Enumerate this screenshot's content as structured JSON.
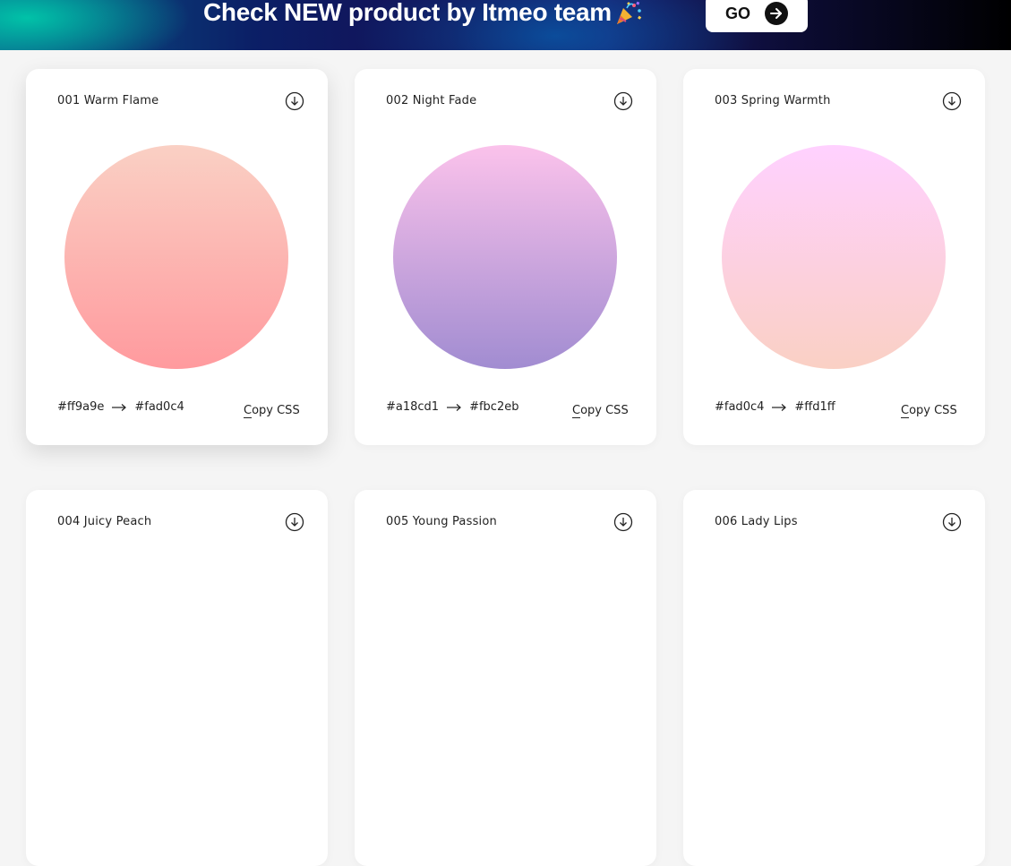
{
  "banner": {
    "text": "Check NEW product by Itmeo team",
    "emoji_icon": "party-popper-icon",
    "go_label": "GO",
    "go_icon": "arrow-right-icon"
  },
  "copy_label_first": "C",
  "copy_label_rest": "opy CSS",
  "cards": [
    {
      "title": "001 Warm Flame",
      "from": "#ff9a9e",
      "to": "#fad0c4",
      "from_label": "#ff9a9e",
      "to_label": "#fad0c4"
    },
    {
      "title": "002 Night Fade",
      "from": "#a18cd1",
      "to": "#fbc2eb",
      "from_label": "#a18cd1",
      "to_label": "#fbc2eb"
    },
    {
      "title": "003 Spring Warmth",
      "from": "#fad0c4",
      "to": "#ffd1ff",
      "from_label": "#fad0c4",
      "to_label": "#ffd1ff"
    },
    {
      "title": "004 Juicy Peach"
    },
    {
      "title": "005 Young Passion"
    },
    {
      "title": "006 Lady Lips"
    }
  ]
}
